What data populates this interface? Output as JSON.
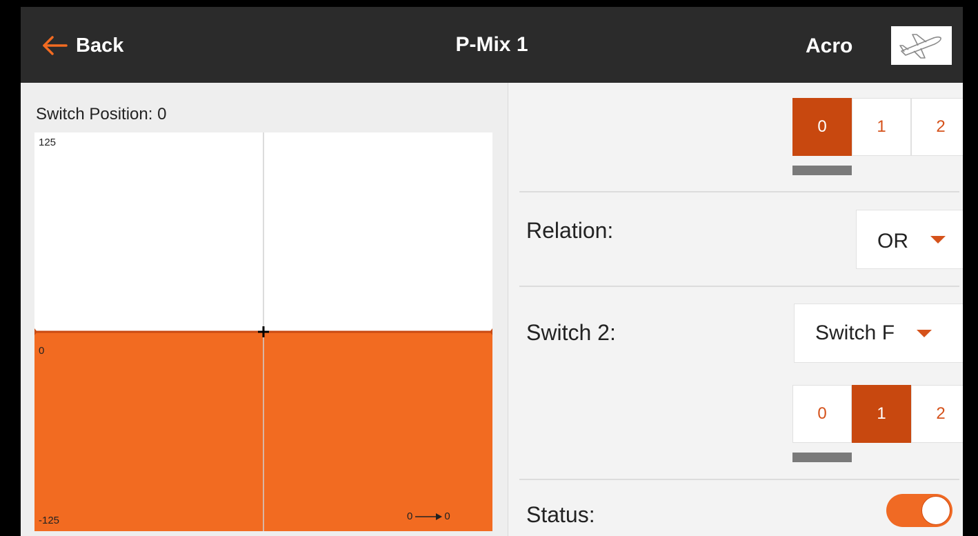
{
  "header": {
    "back_label": "Back",
    "title": "P-Mix 1",
    "model_type": "Acro",
    "back_icon": "arrow-left-icon",
    "model_icon": "airplane-icon"
  },
  "graph_panel": {
    "switch_position_label": "Switch Position: 0",
    "y_max_label": "125",
    "y_zero_label": "0",
    "y_min_label": "-125",
    "io_label": "0",
    "io_label_out": "0",
    "mix_level": 0,
    "colors": {
      "fill": "#f26b21",
      "line": "#c94a12",
      "grid": "#d0d0d0",
      "crosshair": "#000000"
    }
  },
  "switch1": {
    "positions": [
      "0",
      "1",
      "2"
    ],
    "active_index": 0
  },
  "relation": {
    "label": "Relation:",
    "value": "OR"
  },
  "switch2": {
    "label": "Switch 2:",
    "value": "Switch F",
    "positions": [
      "0",
      "1",
      "2"
    ],
    "active_index": 1
  },
  "status": {
    "label": "Status:",
    "enabled": true
  },
  "colors": {
    "accent": "#d5521b",
    "accent_dark": "#c8480f",
    "header_bg": "#2b2b2b"
  }
}
